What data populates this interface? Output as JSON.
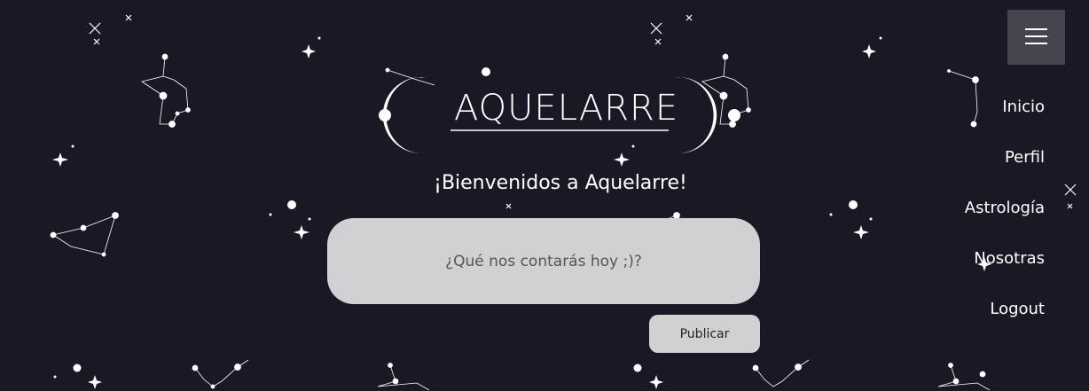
{
  "header": {
    "logo_text": "AQUELARRE",
    "menu_icon": "hamburger-menu-icon"
  },
  "welcome": {
    "title": "¡Bienvenidos a Aquelarre!"
  },
  "post": {
    "placeholder": "¿Qué nos contarás hoy ;)?",
    "value": "",
    "publish_label": "Publicar"
  },
  "nav": {
    "items": [
      {
        "label": "Inicio"
      },
      {
        "label": "Perfil"
      },
      {
        "label": "Astrología"
      },
      {
        "label": "Nosotras"
      },
      {
        "label": "Logout"
      }
    ]
  },
  "colors": {
    "background": "#1b1826",
    "input_background": "#d1d0d3",
    "menu_button": "#47444f",
    "text": "#ffffff"
  }
}
